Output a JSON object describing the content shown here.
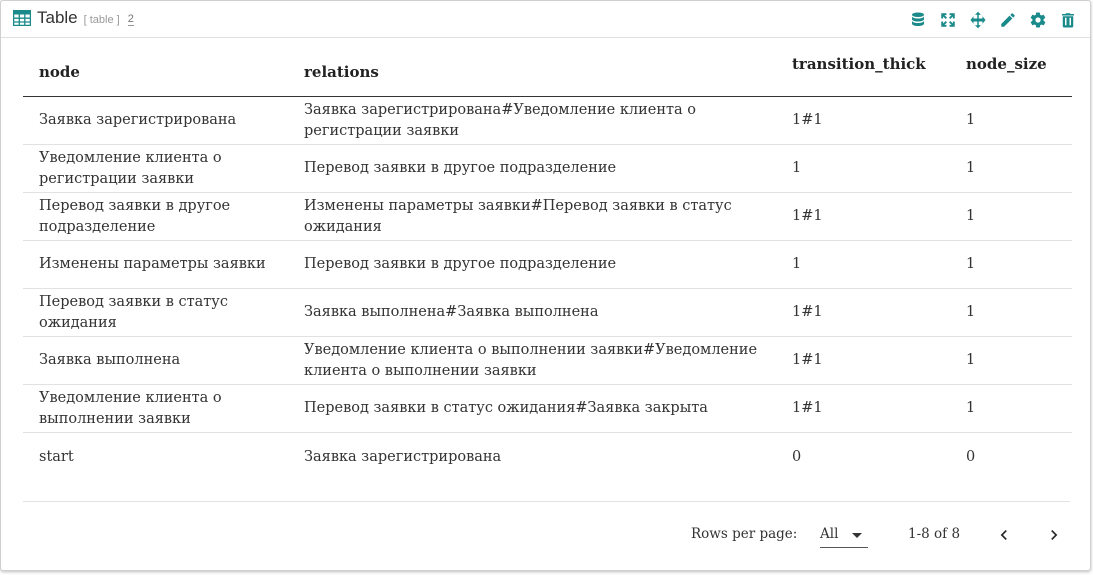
{
  "header": {
    "title": "Table",
    "type_tag": "[ table ]",
    "count": "2"
  },
  "toolbar": {
    "icons": [
      "database-icon",
      "fullscreen-icon",
      "move-icon",
      "edit-icon",
      "settings-icon",
      "delete-icon"
    ]
  },
  "colors": {
    "accent": "#1b8a8a"
  },
  "table": {
    "columns": [
      "node",
      "relations",
      "transition_thick",
      "node_size"
    ],
    "rows": [
      [
        "Заявка зарегистрирована",
        "Заявка зарегистрирована#Уведомление клиента о регистрации заявки",
        "1#1",
        "1"
      ],
      [
        "Уведомление клиента о регистрации заявки",
        "Перевод заявки в другое подразделение",
        "1",
        "1"
      ],
      [
        "Перевод заявки в другое подразделение",
        "Изменены параметры заявки#Перевод заявки в статус ожидания",
        "1#1",
        "1"
      ],
      [
        "Изменены параметры заявки",
        "Перевод заявки в другое подразделение",
        "1",
        "1"
      ],
      [
        "Перевод заявки в статус ожидания",
        "Заявка выполнена#Заявка выполнена",
        "1#1",
        "1"
      ],
      [
        "Заявка выполнена",
        "Уведомление клиента о выполнении заявки#Уведомление клиента о выполнении заявки",
        "1#1",
        "1"
      ],
      [
        "Уведомление клиента о выполнении заявки",
        "Перевод заявки в статус ожидания#Заявка закрыта",
        "1#1",
        "1"
      ],
      [
        "start",
        "Заявка зарегистрирована",
        "0",
        "0"
      ]
    ]
  },
  "footer": {
    "rows_per_page_label": "Rows per page:",
    "rows_per_page_value": "All",
    "page_info": "1-8 of 8"
  }
}
